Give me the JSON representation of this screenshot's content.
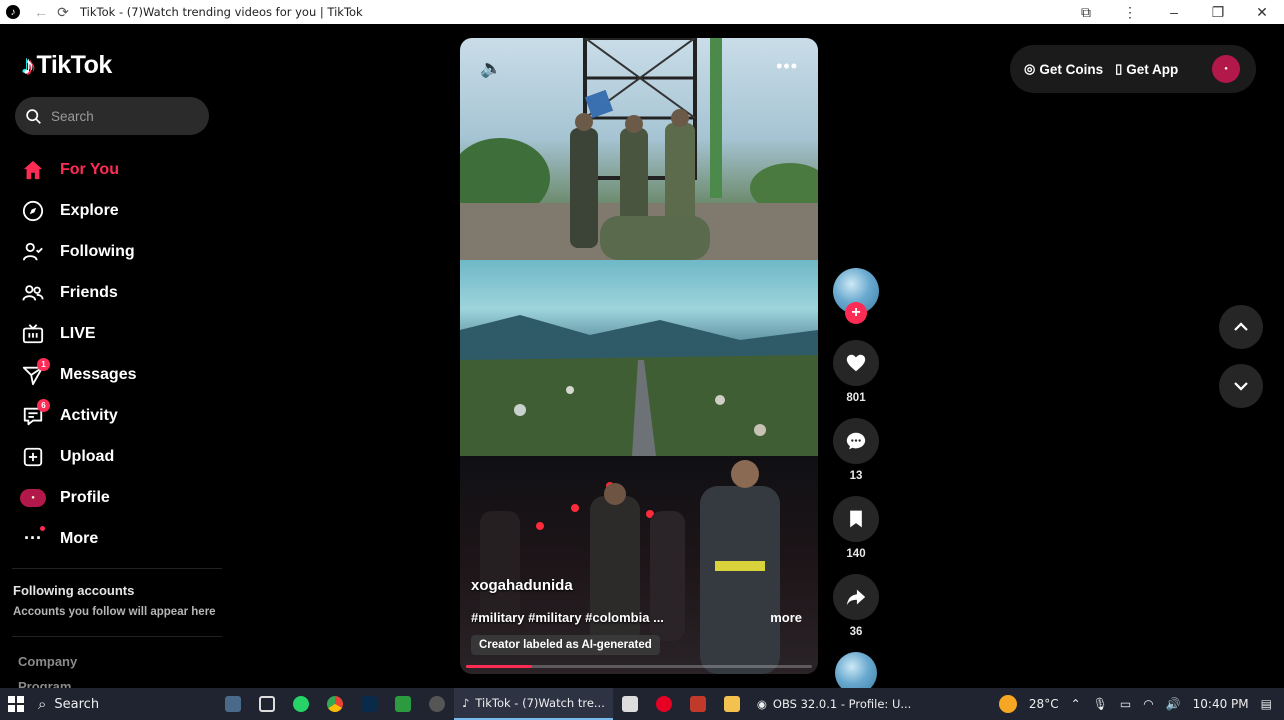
{
  "browser": {
    "title": "TikTok - (7)Watch trending videos for you | TikTok"
  },
  "sidebar": {
    "logo_text": "TikTok",
    "search_placeholder": "Search",
    "items": [
      {
        "label": "For You",
        "icon": "home-icon",
        "active": true
      },
      {
        "label": "Explore",
        "icon": "compass-icon"
      },
      {
        "label": "Following",
        "icon": "user-follow-icon"
      },
      {
        "label": "Friends",
        "icon": "friends-icon"
      },
      {
        "label": "LIVE",
        "icon": "live-tv-icon"
      },
      {
        "label": "Messages",
        "icon": "send-icon",
        "badge": "1"
      },
      {
        "label": "Activity",
        "icon": "activity-icon",
        "badge": "6"
      },
      {
        "label": "Upload",
        "icon": "plus-square-icon"
      },
      {
        "label": "Profile",
        "icon": "profile-avatar"
      },
      {
        "label": "More",
        "icon": "more-dots-icon"
      }
    ],
    "following_title": "Following accounts",
    "following_sub": "Accounts you follow will appear here",
    "footer_company": "Company",
    "footer_program": "Program"
  },
  "video": {
    "username": "xogahadunida",
    "hashtags": "#military #military  #colombia ...",
    "more": "more",
    "ai_label": "Creator labeled as AI-generated",
    "progress": 0.19
  },
  "actions": {
    "likes": "801",
    "comments": "13",
    "saves": "140",
    "shares": "36"
  },
  "topright": {
    "coins": "Get Coins",
    "app": "Get App"
  },
  "taskbar": {
    "search": "Search",
    "tiktok_window": "TikTok - (7)Watch tre...",
    "obs_window": "OBS 32.0.1 - Profile: U...",
    "temperature": "28°C",
    "time": "10:40 PM"
  },
  "colors": {
    "accent": "#fe2c55",
    "background": "#000000",
    "surface": "#262626"
  }
}
